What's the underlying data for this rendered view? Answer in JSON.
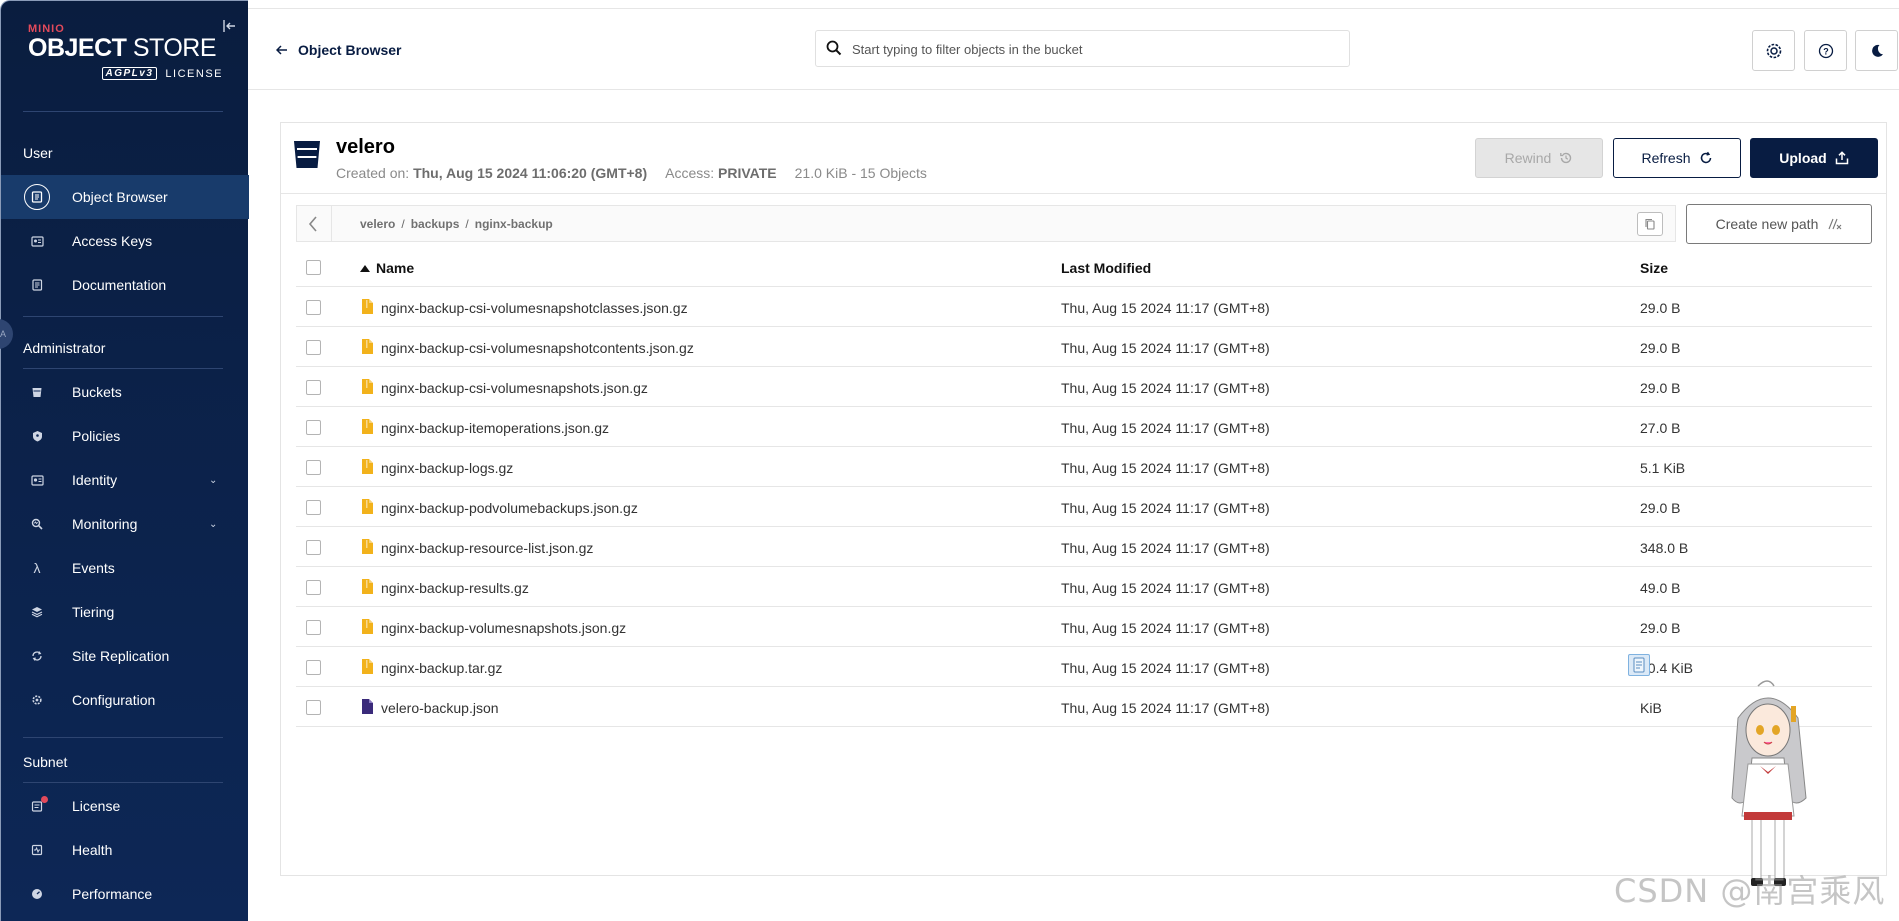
{
  "brand": {
    "minio": "MINIO",
    "object": "OBJECT",
    "store": " STORE",
    "agpl": "AGPLv3",
    "license": "LICENSE"
  },
  "sidebar": {
    "sections": {
      "user": "User",
      "administrator": "Administrator",
      "subnet": "Subnet"
    },
    "user_items": [
      {
        "label": "Object Browser",
        "icon": "object-browser-icon"
      },
      {
        "label": "Access Keys",
        "icon": "access-keys-icon"
      },
      {
        "label": "Documentation",
        "icon": "documentation-icon"
      }
    ],
    "admin_items": [
      {
        "label": "Buckets",
        "icon": "buckets-icon"
      },
      {
        "label": "Policies",
        "icon": "policies-icon"
      },
      {
        "label": "Identity",
        "icon": "identity-icon"
      },
      {
        "label": "Monitoring",
        "icon": "monitoring-icon"
      },
      {
        "label": "Events",
        "icon": "lambda-icon"
      },
      {
        "label": "Tiering",
        "icon": "tiering-icon"
      },
      {
        "label": "Site Replication",
        "icon": "site-replication-icon"
      },
      {
        "label": "Configuration",
        "icon": "gear-icon"
      }
    ],
    "subnet_items": [
      {
        "label": "License",
        "icon": "license-icon"
      },
      {
        "label": "Health",
        "icon": "health-icon"
      },
      {
        "label": "Performance",
        "icon": "performance-icon"
      }
    ]
  },
  "topbar": {
    "back_label": "Object Browser",
    "search_placeholder": "Start typing to filter objects in the bucket"
  },
  "bucket": {
    "name": "velero",
    "created_label": "Created on:",
    "created_value": "Thu, Aug 15 2024 11:06:20 (GMT+8)",
    "access_label": "Access:",
    "access_value": "PRIVATE",
    "usage": "21.0 KiB - 15 Objects"
  },
  "actions": {
    "rewind": "Rewind",
    "refresh": "Refresh",
    "upload": "Upload",
    "create_new_path": "Create new path"
  },
  "breadcrumb": [
    "velero",
    "backups",
    "nginx-backup"
  ],
  "table": {
    "headers": {
      "name": "Name",
      "modified": "Last Modified",
      "size": "Size"
    },
    "rows": [
      {
        "name": "nginx-backup-csi-volumesnapshotclasses.json.gz",
        "modified": "Thu, Aug 15 2024 11:17 (GMT+8)",
        "size": "29.0 B",
        "type": "archive"
      },
      {
        "name": "nginx-backup-csi-volumesnapshotcontents.json.gz",
        "modified": "Thu, Aug 15 2024 11:17 (GMT+8)",
        "size": "29.0 B",
        "type": "archive"
      },
      {
        "name": "nginx-backup-csi-volumesnapshots.json.gz",
        "modified": "Thu, Aug 15 2024 11:17 (GMT+8)",
        "size": "29.0 B",
        "type": "archive"
      },
      {
        "name": "nginx-backup-itemoperations.json.gz",
        "modified": "Thu, Aug 15 2024 11:17 (GMT+8)",
        "size": "27.0 B",
        "type": "archive"
      },
      {
        "name": "nginx-backup-logs.gz",
        "modified": "Thu, Aug 15 2024 11:17 (GMT+8)",
        "size": "5.1 KiB",
        "type": "archive"
      },
      {
        "name": "nginx-backup-podvolumebackups.json.gz",
        "modified": "Thu, Aug 15 2024 11:17 (GMT+8)",
        "size": "29.0 B",
        "type": "archive"
      },
      {
        "name": "nginx-backup-resource-list.json.gz",
        "modified": "Thu, Aug 15 2024 11:17 (GMT+8)",
        "size": "348.0 B",
        "type": "archive"
      },
      {
        "name": "nginx-backup-results.gz",
        "modified": "Thu, Aug 15 2024 11:17 (GMT+8)",
        "size": "49.0 B",
        "type": "archive"
      },
      {
        "name": "nginx-backup-volumesnapshots.json.gz",
        "modified": "Thu, Aug 15 2024 11:17 (GMT+8)",
        "size": "29.0 B",
        "type": "archive"
      },
      {
        "name": "nginx-backup.tar.gz",
        "modified": "Thu, Aug 15 2024 11:17 (GMT+8)",
        "size": "10.4 KiB",
        "type": "archive"
      },
      {
        "name": "velero-backup.json",
        "modified": "Thu, Aug 15 2024 11:17 (GMT+8)",
        "size": "KiB",
        "type": "document"
      }
    ]
  },
  "watermark": "CSDN @南宫乘风",
  "colors": {
    "sidebar_bg": "#0a1d3f",
    "accent": "#081c42",
    "archive_icon": "#f2b21b",
    "document_icon": "#3a2a7a",
    "license_dot": "#e24a5b"
  }
}
